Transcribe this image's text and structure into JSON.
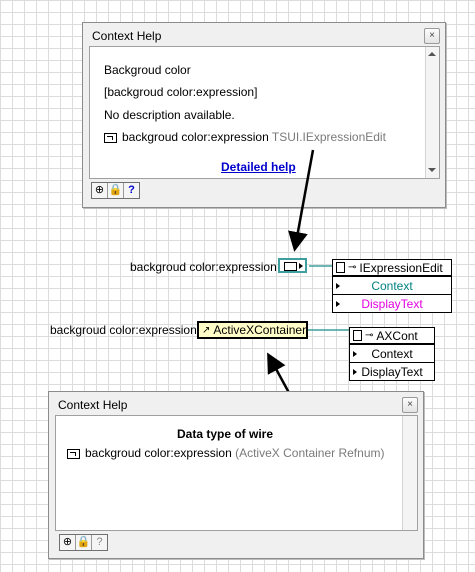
{
  "help_top": {
    "title": "Context Help",
    "close": "×",
    "heading": "Backgroud color",
    "type_line": "[backgroud color:expression]",
    "desc": "No description available.",
    "item_label": "backgroud color:expression",
    "item_type": "TSUI.IExpressionEdit",
    "link": "Detailed help",
    "buttons": [
      "⊕",
      "🔒",
      "?"
    ]
  },
  "node1": {
    "label": "backgroud color:expression",
    "title": "IExpressionEdit",
    "rows": [
      "Context",
      "DisplayText"
    ],
    "row_colors": [
      "#008080",
      "#e000e0"
    ]
  },
  "node2": {
    "label": "backgroud color:expression",
    "refnum": "ActiveXContainer",
    "title": "AXCont",
    "rows": [
      "Context",
      "DisplayText"
    ]
  },
  "help_bottom": {
    "title": "Context Help",
    "close": "×",
    "heading": "Data type of wire",
    "item_label": "backgroud color:expression",
    "item_type": "(ActiveX Container Refnum)",
    "buttons": [
      "⊕",
      "🔒",
      "?"
    ]
  },
  "colors": {
    "teal_wire": "#3f9f9f",
    "refnum_bg": "#fffcc8"
  }
}
